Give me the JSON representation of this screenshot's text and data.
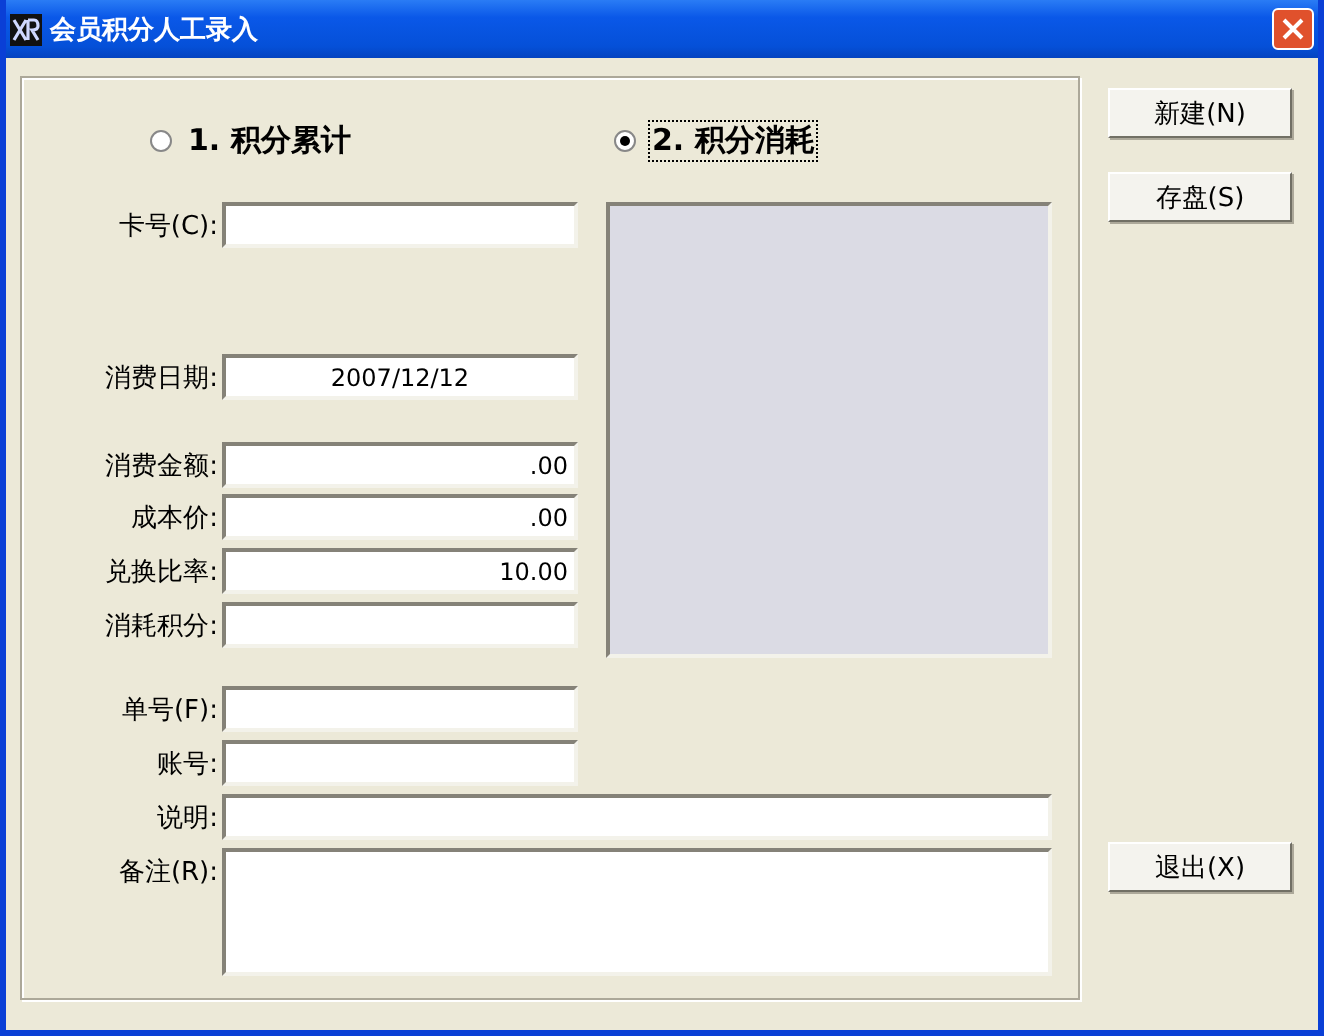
{
  "window": {
    "title": "会员积分人工录入"
  },
  "radios": [
    {
      "label": "1. 积分累计",
      "selected": false
    },
    {
      "label": "2. 积分消耗",
      "selected": true
    }
  ],
  "fields": [
    {
      "label": "卡号(C):",
      "kind": "text"
    },
    {
      "label": "消费日期:",
      "value": "2007/12/12",
      "kind": "date"
    },
    {
      "label": "消费金额:",
      "value": ".00",
      "kind": "amount"
    },
    {
      "label": "成本价:",
      "value": ".00",
      "kind": "amount"
    },
    {
      "label": "兑换比率:",
      "value": "10.00",
      "kind": "amount"
    },
    {
      "label": "消耗积分:",
      "kind": "text"
    },
    {
      "label": "单号(F):",
      "kind": "text"
    },
    {
      "label": "账号:",
      "kind": "text"
    },
    {
      "label": "说明:",
      "kind": "wide"
    },
    {
      "label": "备注(R):",
      "kind": "memo"
    }
  ],
  "buttons": [
    {
      "label": "新建(N)"
    },
    {
      "label": "存盘(S)"
    },
    {
      "label": "退出(X)"
    }
  ]
}
